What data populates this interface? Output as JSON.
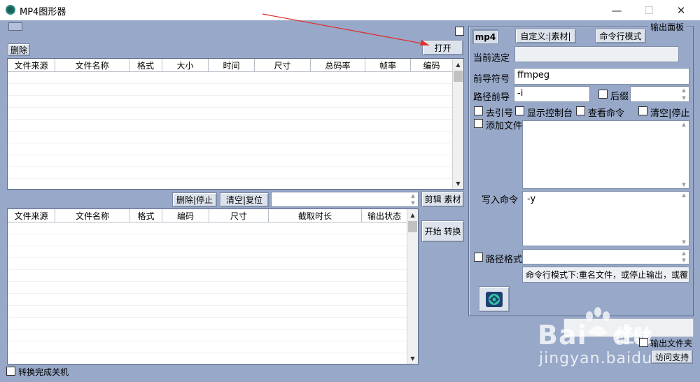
{
  "window": {
    "title": "MP4图形器",
    "minimize": "—",
    "maximize": "☐",
    "close": "✕"
  },
  "top": {
    "delete_label": "删除",
    "open_label": "打开",
    "file_table": {
      "columns": [
        "文件来源",
        "文件名称",
        "格式",
        "大小",
        "时间",
        "尺寸",
        "总码率",
        "帧率",
        "编码"
      ]
    }
  },
  "middle": {
    "delete_stop_label": "删除|停止",
    "clear_reset_label": "清空|复位",
    "edit_material_label": "剪辑 素材",
    "start_convert_label": "开始 转换",
    "task_table": {
      "columns": [
        "文件来源",
        "文件名称",
        "格式",
        "编码",
        "尺寸",
        "截取时长",
        "输出状态"
      ]
    }
  },
  "bottom": {
    "shutdown_label": "转换完成关机"
  },
  "panel": {
    "title": "输出面板",
    "mp4_label": "mp4",
    "custom_label": "自定义:|素材|",
    "cmd_mode_label": "命令行模式",
    "current_label": "当前选定",
    "current_value": "",
    "prefix_label": "前导符号",
    "prefix_value": "ffmpeg",
    "path_prefix_label": "路径前导",
    "path_prefix_value": "-i",
    "suffix_label": "后缀",
    "suffix_value": "",
    "unquote_label": "去引号",
    "show_console_label": "显示控制台",
    "view_cmd_label": "查看命令",
    "clear_stop_label": "清空|停止",
    "add_file_label": "添加文件",
    "write_cmd_label": "写入命令",
    "write_cmd_value": "-y",
    "path_format_label": "路径格式",
    "hint_text": "命令行模式下:重名文件，或停止输出，或覆",
    "output_folder_label": "输出文件夹",
    "support_label": "访问支持"
  },
  "watermark": {
    "brand": "Bai",
    "brand_cn": "经验",
    "brand_du": "du",
    "url": "jingyan.baidu.com"
  }
}
